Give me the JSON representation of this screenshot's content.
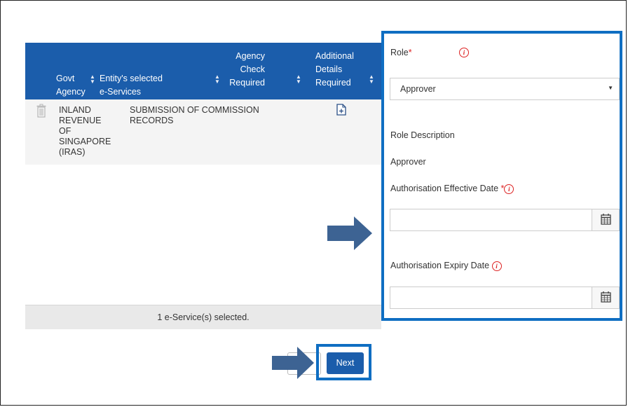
{
  "table": {
    "columns": {
      "govt_agency": [
        "Govt",
        "Agency"
      ],
      "entity_services": [
        "Entity's selected",
        "e-Services"
      ],
      "agency_check": [
        "Agency",
        "Check",
        "Required"
      ],
      "additional_details": [
        "Additional",
        "Details",
        "Required"
      ]
    },
    "rows": [
      {
        "agency": [
          "INLAND",
          "REVENUE OF",
          "SINGAPORE",
          "(IRAS)"
        ],
        "service": [
          "SUBMISSION OF COMMISSION",
          "RECORDS"
        ]
      }
    ],
    "footer": "1 e-Service(s) selected."
  },
  "form": {
    "role_label": "Role",
    "required_mark": "*",
    "role_value": "Approver",
    "role_description_label": "Role Description",
    "role_description_value": "Approver",
    "effective_date_label": "Authorisation Effective Date",
    "expiry_date_label": "Authorisation Expiry Date",
    "info_glyph": "i"
  },
  "buttons": {
    "next_label": "Next"
  },
  "colors": {
    "header_blue": "#1b5dab",
    "highlight_blue": "#0f6ec2",
    "arrow": "#3d6393",
    "required_red": "#dd2222"
  }
}
